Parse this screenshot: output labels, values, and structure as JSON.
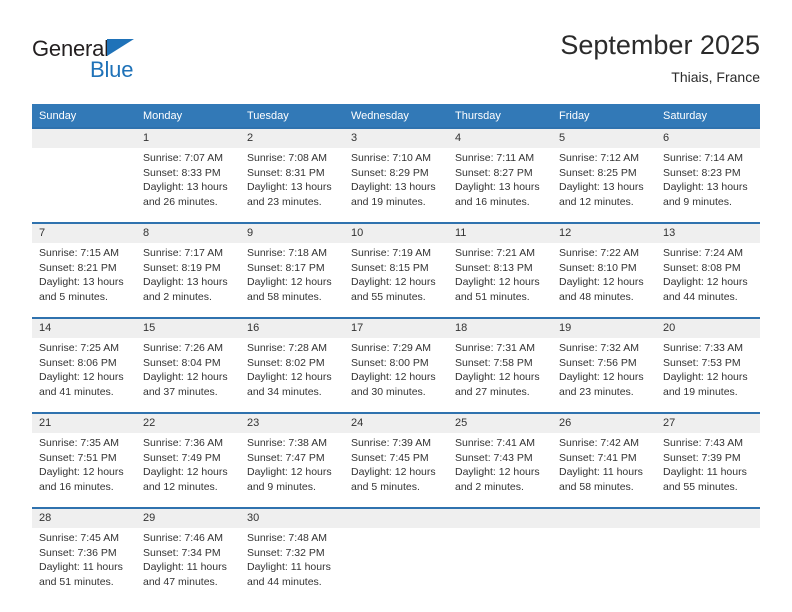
{
  "logo": {
    "primary_text": "General",
    "secondary_text": "Blue",
    "triangle_color": "#1f72b8",
    "primary_color": "#231f20",
    "secondary_color": "#1f72b8"
  },
  "header": {
    "title": "September 2025",
    "subtitle": "Thiais, France"
  },
  "theme": {
    "header_bg": "#3279b7",
    "header_text": "#ffffff",
    "row_rule": "#2f72ae",
    "daynum_bg": "#efefef",
    "body_text": "#333333"
  },
  "calendar": {
    "weekday_headers": [
      "Sunday",
      "Monday",
      "Tuesday",
      "Wednesday",
      "Thursday",
      "Friday",
      "Saturday"
    ],
    "weeks": [
      [
        {
          "day": "",
          "lines": []
        },
        {
          "day": "1",
          "lines": [
            "Sunrise: 7:07 AM",
            "Sunset: 8:33 PM",
            "Daylight: 13 hours",
            "and 26 minutes."
          ]
        },
        {
          "day": "2",
          "lines": [
            "Sunrise: 7:08 AM",
            "Sunset: 8:31 PM",
            "Daylight: 13 hours",
            "and 23 minutes."
          ]
        },
        {
          "day": "3",
          "lines": [
            "Sunrise: 7:10 AM",
            "Sunset: 8:29 PM",
            "Daylight: 13 hours",
            "and 19 minutes."
          ]
        },
        {
          "day": "4",
          "lines": [
            "Sunrise: 7:11 AM",
            "Sunset: 8:27 PM",
            "Daylight: 13 hours",
            "and 16 minutes."
          ]
        },
        {
          "day": "5",
          "lines": [
            "Sunrise: 7:12 AM",
            "Sunset: 8:25 PM",
            "Daylight: 13 hours",
            "and 12 minutes."
          ]
        },
        {
          "day": "6",
          "lines": [
            "Sunrise: 7:14 AM",
            "Sunset: 8:23 PM",
            "Daylight: 13 hours",
            "and 9 minutes."
          ]
        }
      ],
      [
        {
          "day": "7",
          "lines": [
            "Sunrise: 7:15 AM",
            "Sunset: 8:21 PM",
            "Daylight: 13 hours",
            "and 5 minutes."
          ]
        },
        {
          "day": "8",
          "lines": [
            "Sunrise: 7:17 AM",
            "Sunset: 8:19 PM",
            "Daylight: 13 hours",
            "and 2 minutes."
          ]
        },
        {
          "day": "9",
          "lines": [
            "Sunrise: 7:18 AM",
            "Sunset: 8:17 PM",
            "Daylight: 12 hours",
            "and 58 minutes."
          ]
        },
        {
          "day": "10",
          "lines": [
            "Sunrise: 7:19 AM",
            "Sunset: 8:15 PM",
            "Daylight: 12 hours",
            "and 55 minutes."
          ]
        },
        {
          "day": "11",
          "lines": [
            "Sunrise: 7:21 AM",
            "Sunset: 8:13 PM",
            "Daylight: 12 hours",
            "and 51 minutes."
          ]
        },
        {
          "day": "12",
          "lines": [
            "Sunrise: 7:22 AM",
            "Sunset: 8:10 PM",
            "Daylight: 12 hours",
            "and 48 minutes."
          ]
        },
        {
          "day": "13",
          "lines": [
            "Sunrise: 7:24 AM",
            "Sunset: 8:08 PM",
            "Daylight: 12 hours",
            "and 44 minutes."
          ]
        }
      ],
      [
        {
          "day": "14",
          "lines": [
            "Sunrise: 7:25 AM",
            "Sunset: 8:06 PM",
            "Daylight: 12 hours",
            "and 41 minutes."
          ]
        },
        {
          "day": "15",
          "lines": [
            "Sunrise: 7:26 AM",
            "Sunset: 8:04 PM",
            "Daylight: 12 hours",
            "and 37 minutes."
          ]
        },
        {
          "day": "16",
          "lines": [
            "Sunrise: 7:28 AM",
            "Sunset: 8:02 PM",
            "Daylight: 12 hours",
            "and 34 minutes."
          ]
        },
        {
          "day": "17",
          "lines": [
            "Sunrise: 7:29 AM",
            "Sunset: 8:00 PM",
            "Daylight: 12 hours",
            "and 30 minutes."
          ]
        },
        {
          "day": "18",
          "lines": [
            "Sunrise: 7:31 AM",
            "Sunset: 7:58 PM",
            "Daylight: 12 hours",
            "and 27 minutes."
          ]
        },
        {
          "day": "19",
          "lines": [
            "Sunrise: 7:32 AM",
            "Sunset: 7:56 PM",
            "Daylight: 12 hours",
            "and 23 minutes."
          ]
        },
        {
          "day": "20",
          "lines": [
            "Sunrise: 7:33 AM",
            "Sunset: 7:53 PM",
            "Daylight: 12 hours",
            "and 19 minutes."
          ]
        }
      ],
      [
        {
          "day": "21",
          "lines": [
            "Sunrise: 7:35 AM",
            "Sunset: 7:51 PM",
            "Daylight: 12 hours",
            "and 16 minutes."
          ]
        },
        {
          "day": "22",
          "lines": [
            "Sunrise: 7:36 AM",
            "Sunset: 7:49 PM",
            "Daylight: 12 hours",
            "and 12 minutes."
          ]
        },
        {
          "day": "23",
          "lines": [
            "Sunrise: 7:38 AM",
            "Sunset: 7:47 PM",
            "Daylight: 12 hours",
            "and 9 minutes."
          ]
        },
        {
          "day": "24",
          "lines": [
            "Sunrise: 7:39 AM",
            "Sunset: 7:45 PM",
            "Daylight: 12 hours",
            "and 5 minutes."
          ]
        },
        {
          "day": "25",
          "lines": [
            "Sunrise: 7:41 AM",
            "Sunset: 7:43 PM",
            "Daylight: 12 hours",
            "and 2 minutes."
          ]
        },
        {
          "day": "26",
          "lines": [
            "Sunrise: 7:42 AM",
            "Sunset: 7:41 PM",
            "Daylight: 11 hours",
            "and 58 minutes."
          ]
        },
        {
          "day": "27",
          "lines": [
            "Sunrise: 7:43 AM",
            "Sunset: 7:39 PM",
            "Daylight: 11 hours",
            "and 55 minutes."
          ]
        }
      ],
      [
        {
          "day": "28",
          "lines": [
            "Sunrise: 7:45 AM",
            "Sunset: 7:36 PM",
            "Daylight: 11 hours",
            "and 51 minutes."
          ]
        },
        {
          "day": "29",
          "lines": [
            "Sunrise: 7:46 AM",
            "Sunset: 7:34 PM",
            "Daylight: 11 hours",
            "and 47 minutes."
          ]
        },
        {
          "day": "30",
          "lines": [
            "Sunrise: 7:48 AM",
            "Sunset: 7:32 PM",
            "Daylight: 11 hours",
            "and 44 minutes."
          ]
        },
        {
          "day": "",
          "lines": []
        },
        {
          "day": "",
          "lines": []
        },
        {
          "day": "",
          "lines": []
        },
        {
          "day": "",
          "lines": []
        }
      ]
    ]
  }
}
